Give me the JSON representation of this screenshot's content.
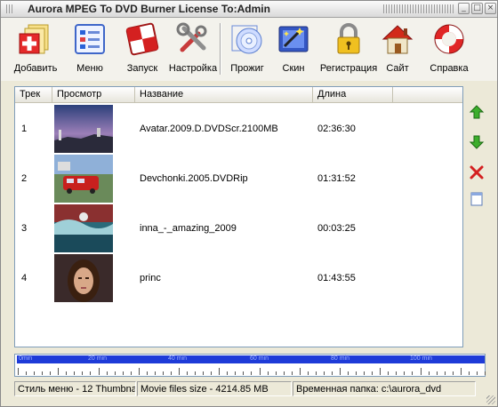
{
  "window": {
    "title": "Aurora MPEG To DVD Burner  License To:Admin"
  },
  "toolbar": [
    {
      "label": "Добавить",
      "icon": "add-files-icon"
    },
    {
      "label": "Меню",
      "icon": "menu-icon"
    },
    {
      "label": "Запуск",
      "icon": "start-icon"
    },
    {
      "label": "Настройка",
      "icon": "settings-icon"
    },
    {
      "label": "Прожиг",
      "icon": "burn-disc-icon"
    },
    {
      "label": "Скин",
      "icon": "skin-icon"
    },
    {
      "label": "Регистрация",
      "icon": "lock-icon"
    },
    {
      "label": "Сайт",
      "icon": "home-icon"
    },
    {
      "label": "Справка",
      "icon": "help-lifebuoy-icon"
    }
  ],
  "list": {
    "columns": [
      "Трек",
      "Просмотр",
      "Название",
      "Длина"
    ],
    "rows": [
      {
        "track": "1",
        "name": "Avatar.2009.D.DVDScr.2100MB",
        "length": "02:36:30"
      },
      {
        "track": "2",
        "name": "Devchonki.2005.DVDRip",
        "length": "01:31:52"
      },
      {
        "track": "3",
        "name": "inna_-_amazing_2009",
        "length": "00:03:25"
      },
      {
        "track": "4",
        "name": "princ",
        "length": "01:43:55"
      }
    ]
  },
  "side_buttons": [
    "move-up-icon",
    "move-down-icon",
    "delete-icon",
    "properties-icon"
  ],
  "timeline": {
    "labels": [
      "0min",
      "20 min",
      "40 min",
      "60 min",
      "80 min",
      "100 min"
    ]
  },
  "status": {
    "menu_style": "Стиль меню - 12 Thumbnail",
    "files_size": "Movie files size - 4214.85 MB",
    "temp_folder": "Временная папка: c:\\aurora_dvd"
  }
}
